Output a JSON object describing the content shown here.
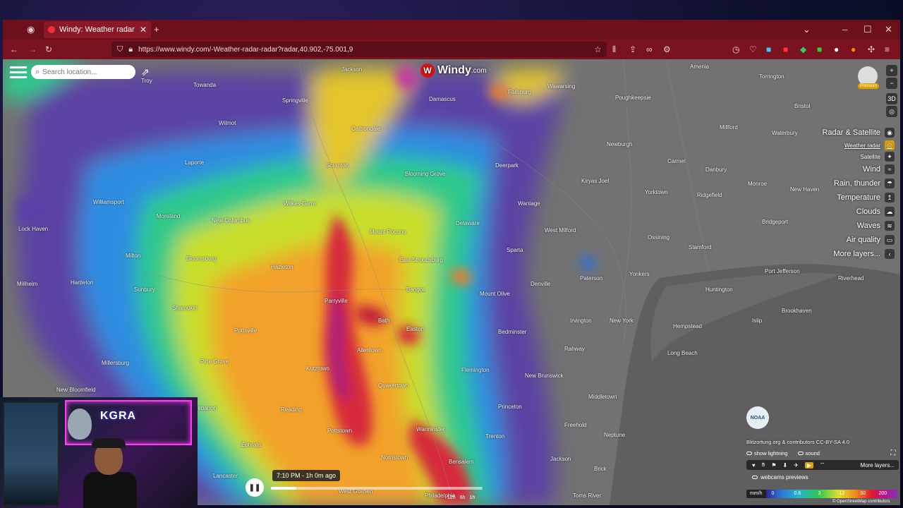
{
  "browser": {
    "tab_title": "Windy: Weather radar",
    "url": "https://www.windy.com/-Weather-radar-radar?radar,40.902,-75.001,9"
  },
  "search": {
    "placeholder": "Search location..."
  },
  "logo": {
    "name": "Windy",
    "suffix": ".com"
  },
  "user": {
    "badge": "Premium"
  },
  "map_controls": [
    "3D"
  ],
  "layers": [
    {
      "label": "Radar & Satellite",
      "kind": "main",
      "icon": "satellite-icon"
    },
    {
      "label": "Weather radar",
      "kind": "sub-active",
      "icon": "radar-icon"
    },
    {
      "label": "Satellite",
      "kind": "sub",
      "icon": "satellite-sub-icon"
    },
    {
      "label": "Wind",
      "kind": "main",
      "icon": "wind-icon"
    },
    {
      "label": "Rain, thunder",
      "kind": "main",
      "icon": "rain-icon"
    },
    {
      "label": "Temperature",
      "kind": "main",
      "icon": "thermometer-icon"
    },
    {
      "label": "Clouds",
      "kind": "main",
      "icon": "cloud-icon"
    },
    {
      "label": "Waves",
      "kind": "main",
      "icon": "waves-icon"
    },
    {
      "label": "Air quality",
      "kind": "main",
      "icon": "air-quality-icon"
    },
    {
      "label": "More layers...",
      "kind": "main",
      "icon": "chevron-left-icon"
    }
  ],
  "towns": [
    {
      "name": "Jackson"
    },
    {
      "name": "Towanda"
    },
    {
      "name": "Springville"
    },
    {
      "name": "Damascus"
    },
    {
      "name": "Fallsburg"
    },
    {
      "name": "Wawarsing"
    },
    {
      "name": "Poughkeepsie"
    },
    {
      "name": "Amenia"
    },
    {
      "name": "Torrington"
    },
    {
      "name": "Bristol"
    },
    {
      "name": "Millford"
    },
    {
      "name": "Waterbury"
    },
    {
      "name": "Newburgh"
    },
    {
      "name": "Carbondale"
    },
    {
      "name": "Wilmot"
    },
    {
      "name": "Laporte"
    },
    {
      "name": "Scranton"
    },
    {
      "name": "Blooming Grove"
    },
    {
      "name": "Deerpark"
    },
    {
      "name": "Carmel"
    },
    {
      "name": "Danbury"
    },
    {
      "name": "Kiryas Joel"
    },
    {
      "name": "Monroe"
    },
    {
      "name": "New Haven"
    },
    {
      "name": "Williamsport"
    },
    {
      "name": "Moreland"
    },
    {
      "name": "Wilkes-Barre"
    },
    {
      "name": "Wantage"
    },
    {
      "name": "Yorktown"
    },
    {
      "name": "Ridgefield"
    },
    {
      "name": "Lock Haven"
    },
    {
      "name": "New Columbus"
    },
    {
      "name": "Mount Pocono"
    },
    {
      "name": "Delaware"
    },
    {
      "name": "West Milford"
    },
    {
      "name": "Ossining"
    },
    {
      "name": "Bridgeport"
    },
    {
      "name": "Milton"
    },
    {
      "name": "Bloomsburg"
    },
    {
      "name": "Hazleton"
    },
    {
      "name": "East Stroudsburg"
    },
    {
      "name": "Sparta"
    },
    {
      "name": "Stamford"
    },
    {
      "name": "Yonkers"
    },
    {
      "name": "Port Jefferson"
    },
    {
      "name": "Riverhead"
    },
    {
      "name": "Millheim"
    },
    {
      "name": "Hartleton"
    },
    {
      "name": "Sunbury"
    },
    {
      "name": "Parryville"
    },
    {
      "name": "Bangor"
    },
    {
      "name": "Mount Olive"
    },
    {
      "name": "Denville"
    },
    {
      "name": "Paterson"
    },
    {
      "name": "Huntington"
    },
    {
      "name": "Shamokin"
    },
    {
      "name": "Bath"
    },
    {
      "name": "Easton"
    },
    {
      "name": "Brookhaven"
    },
    {
      "name": "Pottsville"
    },
    {
      "name": "Bedminster"
    },
    {
      "name": "Irvington"
    },
    {
      "name": "New York"
    },
    {
      "name": "Hempstead"
    },
    {
      "name": "Islip"
    },
    {
      "name": "Millersburg"
    },
    {
      "name": "Pine Grove"
    },
    {
      "name": "Allentown"
    },
    {
      "name": "Rahway"
    },
    {
      "name": "Long Beach"
    },
    {
      "name": "Kutztown"
    },
    {
      "name": "Flemington"
    },
    {
      "name": "New Brunswick"
    },
    {
      "name": "New Bloomfield"
    },
    {
      "name": "Quakertown"
    },
    {
      "name": "Middletown"
    },
    {
      "name": "Lebanon"
    },
    {
      "name": "Reading"
    },
    {
      "name": "Princeton"
    },
    {
      "name": "Pottstown"
    },
    {
      "name": "Warminster"
    },
    {
      "name": "Trenton"
    },
    {
      "name": "Freehold"
    },
    {
      "name": "Neptune"
    },
    {
      "name": "Ephrata"
    },
    {
      "name": "Norristown"
    },
    {
      "name": "Bensalem"
    },
    {
      "name": "Jackson"
    },
    {
      "name": "Lancaster"
    },
    {
      "name": "West Goshen"
    },
    {
      "name": "Brick"
    },
    {
      "name": "Philadelphia"
    },
    {
      "name": "Toms River"
    },
    {
      "name": "Troy"
    }
  ],
  "credits": "Blitzortung.org & contributors CC-BY-SA 4.0",
  "toggles": {
    "lightning": "show lightning",
    "sound": "sound"
  },
  "webcams": {
    "more": "More layers...",
    "previews": "webcams previews"
  },
  "legend": {
    "unit": "mm/h",
    "ticks": [
      "0",
      "0.6",
      "3",
      "12",
      "50",
      "200"
    ],
    "attribution": "© OpenStreetMap contributors"
  },
  "timeline": {
    "label": "7:10 PM - 1h 0m ago",
    "progress": 0.12,
    "tick_labels": [
      "12h",
      "6h",
      "1h"
    ]
  },
  "noaa": {
    "label": "NOAA"
  },
  "stream": {
    "sign": "KGRA"
  },
  "colors": {
    "accent": "#e0a000",
    "tabbar": "#6b0f1a",
    "navbar": "#7a1320"
  }
}
